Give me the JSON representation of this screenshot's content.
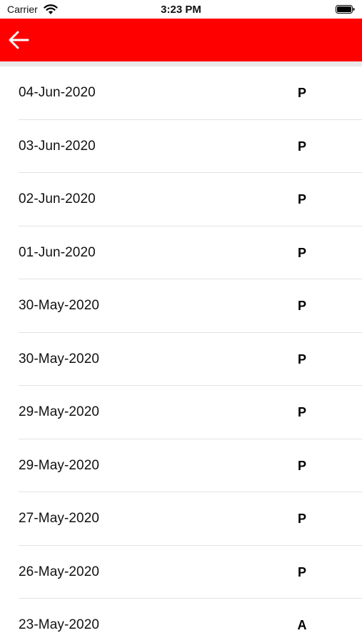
{
  "status_bar": {
    "carrier": "Carrier",
    "time": "3:23 PM",
    "wifi_icon": "wifi-icon",
    "battery_icon": "battery-icon"
  },
  "app_bar": {
    "color": "#fe0000",
    "back_icon": "arrow-left-icon"
  },
  "rows": [
    {
      "date": "04-Jun-2020",
      "status": "P"
    },
    {
      "date": "03-Jun-2020",
      "status": "P"
    },
    {
      "date": "02-Jun-2020",
      "status": "P"
    },
    {
      "date": "01-Jun-2020",
      "status": "P"
    },
    {
      "date": "30-May-2020",
      "status": "P"
    },
    {
      "date": "30-May-2020",
      "status": "P"
    },
    {
      "date": "29-May-2020",
      "status": "P"
    },
    {
      "date": "29-May-2020",
      "status": "P"
    },
    {
      "date": "27-May-2020",
      "status": "P"
    },
    {
      "date": "26-May-2020",
      "status": "P"
    },
    {
      "date": "23-May-2020",
      "status": "A"
    }
  ]
}
